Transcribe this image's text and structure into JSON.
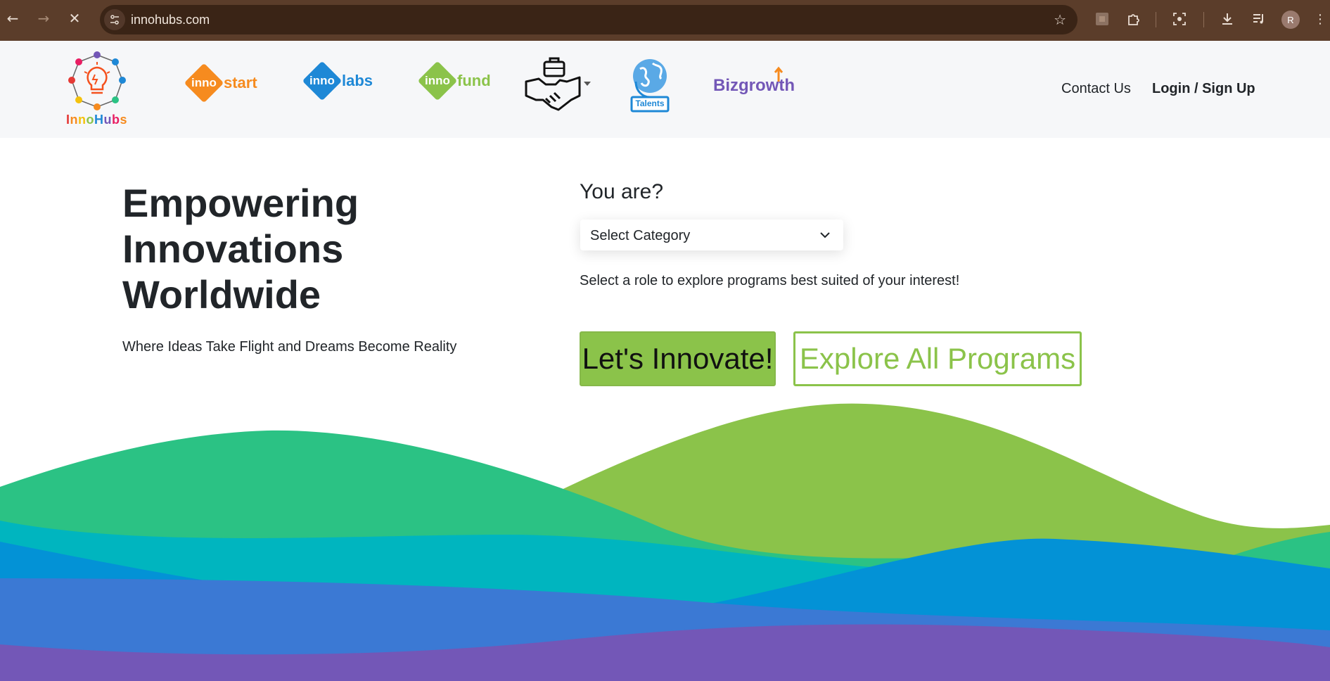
{
  "browser": {
    "url": "innohubs.com",
    "avatar_letter": "R",
    "icons": [
      "back-icon",
      "forward-icon",
      "stop-icon",
      "site-info-icon",
      "bookmark-star-icon",
      "extension-icon",
      "puzzle-icon",
      "screenshot-icon",
      "download-icon",
      "media-icon",
      "avatar",
      "menu-icon"
    ]
  },
  "header": {
    "logo_text": "InnoHubs",
    "brands": [
      {
        "prefix": "inno",
        "suffix": "start",
        "color": "#f68b1f"
      },
      {
        "prefix": "inno",
        "suffix": "labs",
        "color": "#1e88d6"
      },
      {
        "prefix": "inno",
        "suffix": "fund",
        "color": "#8bc34a"
      }
    ],
    "talents_label": "Talents",
    "bizgrowth_label": "Bizgrowth",
    "contact_label": "Contact Us",
    "login_label": "Login / Sign Up"
  },
  "hero": {
    "title": "Empowering Innovations Worldwide",
    "subtitle": "Where Ideas Take Flight and Dreams Become Reality",
    "question": "You are?",
    "select_value": "Select Category",
    "hint": "Select a role to explore programs best suited of your interest!",
    "primary_button": "Let's Innovate!",
    "secondary_button": "Explore All Programs"
  },
  "colors": {
    "accent_green": "#8bc34a",
    "teal": "#2bc284",
    "blue": "#0392d6",
    "purple": "#7357b7",
    "orange": "#f68b1f"
  }
}
